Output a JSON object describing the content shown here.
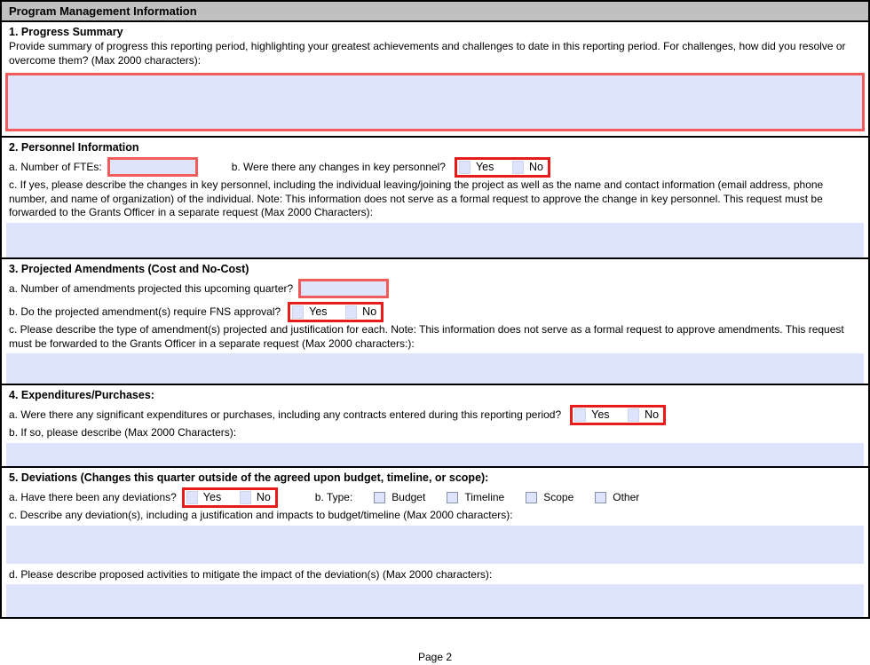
{
  "header": {
    "title": "Program Management Information"
  },
  "footer": {
    "page_label": "Page 2"
  },
  "common": {
    "yes": "Yes",
    "no": "No"
  },
  "colors": {
    "header_bg": "#c0c0c0",
    "field_fill": "#dee4fb",
    "required_field_border": "#f15b5b",
    "required_group_border": "#e81b1b",
    "checkbox_border": "#8590ad",
    "table_border": "#000000"
  },
  "s1": {
    "heading": "1. Progress Summary",
    "prompt": "Provide summary of progress this reporting period, highlighting your greatest achievements and challenges to date in this reporting period. For challenges, how did you resolve or overcome them? (Max 2000 characters):",
    "textarea_value": ""
  },
  "s2": {
    "heading": "2. Personnel Information",
    "a_label": "a. Number of FTEs:",
    "a_value": "",
    "b_label": "b. Were there any changes in key personnel?",
    "c_label": "c. If yes, please describe the changes in key personnel, including the individual leaving/joining the project as well as the name and contact information (email address, phone number, and name of organization) of the individual. Note: This information does not serve as a formal request to approve the change in key personnel. This request must be forwarded to the Grants Officer in a separate request (Max 2000 Characters):",
    "textarea_value": ""
  },
  "s3": {
    "heading": "3. Projected Amendments (Cost and No-Cost)",
    "a_label": "a. Number of amendments projected this upcoming quarter?",
    "a_value": "",
    "b_label": "b. Do the projected amendment(s) require FNS approval?",
    "c_label": "c. Please describe the type of amendment(s) projected and justification for each. Note: This information does not serve as a formal request to approve amendments. This request must be forwarded to the Grants Officer in a separate request (Max 2000 characters:):",
    "textarea_value": ""
  },
  "s4": {
    "heading": "4. Expenditures/Purchases:",
    "a_label": "a. Were there any significant expenditures or purchases, including any contracts entered during this reporting period?",
    "b_label": "b. If so, please describe (Max 2000 Characters):",
    "textarea_value": ""
  },
  "s5": {
    "heading": "5. Deviations (Changes this quarter outside of the agreed upon budget, timeline, or scope):",
    "a_label": "a. Have there been any deviations?",
    "b_label": "b. Type:",
    "type_options": [
      "Budget",
      "Timeline",
      "Scope",
      "Other"
    ],
    "c_label": "c. Describe any deviation(s), including a justification and impacts to budget/timeline (Max 2000 characters):",
    "c_value": "",
    "d_label": "d. Please describe proposed activities to mitigate the impact of the deviation(s) (Max 2000 characters):",
    "d_value": ""
  }
}
